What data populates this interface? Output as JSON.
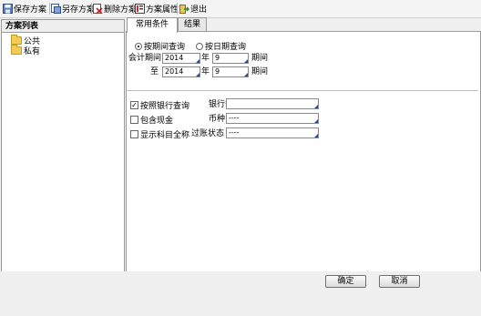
{
  "toolbar": {
    "save_label": "保存方案",
    "save_as_label": "另存方案",
    "delete_label": "删除方案",
    "props_label": "方案属性",
    "exit_label": "退出"
  },
  "left_panel": {
    "title": "方案列表",
    "items": [
      {
        "label": "公共"
      },
      {
        "label": "私有"
      }
    ]
  },
  "tabs": [
    {
      "label": "常用条件",
      "active": true
    },
    {
      "label": "结果",
      "active": false
    }
  ],
  "query_mode": {
    "by_period_label": "按期间查询",
    "by_date_label": "按日期查询",
    "selected": "by_period"
  },
  "period": {
    "accounting_label": "会计期间",
    "to_label": "至",
    "year_unit": "年",
    "period_unit": "期间",
    "from_year": "2014",
    "from_period": "9",
    "to_year": "2014",
    "to_period": "9"
  },
  "options": {
    "by_bank_label": "按照银行查询",
    "by_bank_checked": true,
    "include_cash_label": "包含现金",
    "include_cash_checked": false,
    "show_full_subject_label": "显示科目全称",
    "show_full_subject_checked": false
  },
  "filters": {
    "bank_label": "银行",
    "bank_required_mark": "*",
    "bank_value": "",
    "currency_label": "币种",
    "currency_value": "----",
    "posting_status_label": "过账状态",
    "posting_status_value": "----"
  },
  "buttons": {
    "ok_label": "确定",
    "cancel_label": "取消"
  },
  "colors": {
    "required_mark": "#cc0000",
    "panel_border": "#9a9a9a",
    "folder": "#f3cc55"
  }
}
